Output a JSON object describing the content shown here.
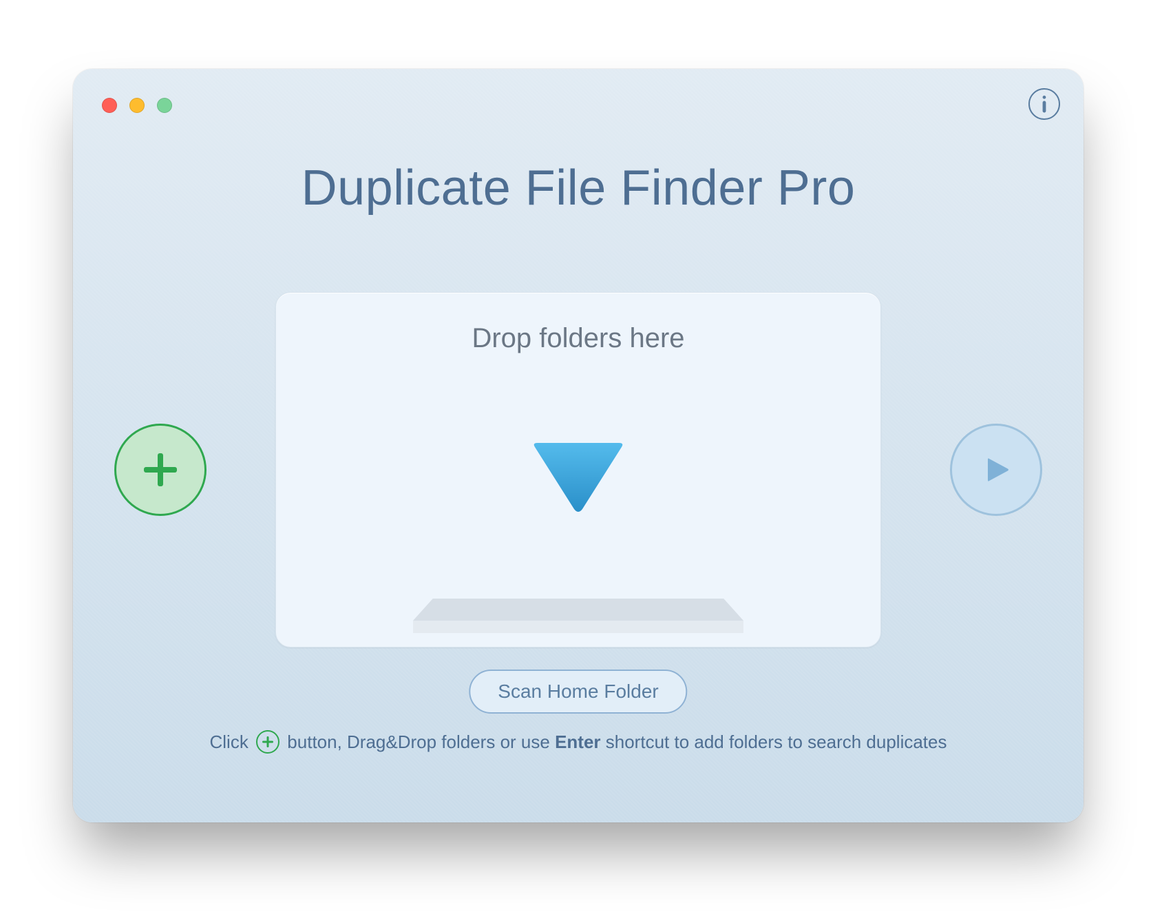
{
  "app_title": "Duplicate File Finder Pro",
  "dropzone_label": "Drop folders here",
  "scan_button_label": "Scan Home Folder",
  "hint": {
    "part1": "Click ",
    "part2": " button, Drag&Drop folders or use ",
    "shortcut": "Enter",
    "part3": " shortcut to add folders to search duplicates"
  },
  "icons": {
    "add": "plus-icon",
    "play": "play-icon",
    "info": "info-icon",
    "drop_arrow": "chevron-down-icon"
  },
  "colors": {
    "accent_green": "#2FA84F",
    "accent_blue": "#42AEE5",
    "title": "#4E6E92"
  }
}
